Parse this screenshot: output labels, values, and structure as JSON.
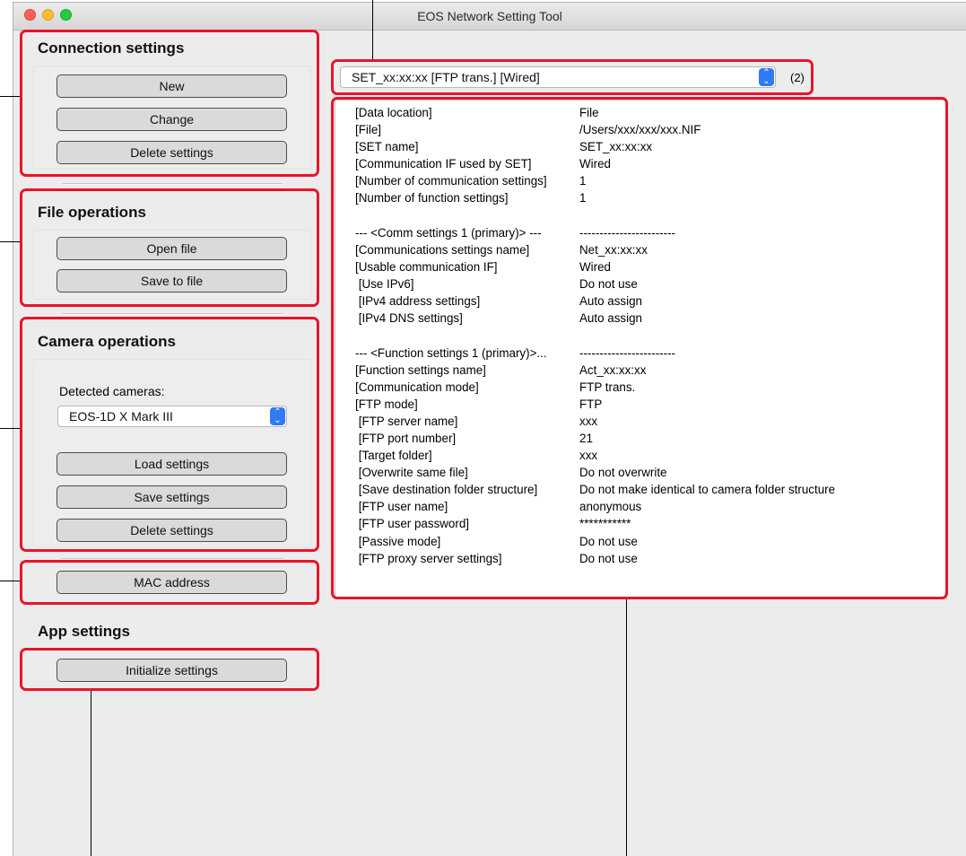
{
  "window": {
    "title": "EOS Network Setting Tool"
  },
  "connection": {
    "heading": "Connection settings",
    "new_label": "New",
    "change_label": "Change",
    "delete_label": "Delete settings"
  },
  "file_ops": {
    "heading": "File operations",
    "open_label": "Open file",
    "save_label": "Save to file"
  },
  "camera_ops": {
    "heading": "Camera operations",
    "detected_label": "Detected cameras:",
    "camera_selected": "EOS-1D X Mark III",
    "load_label": "Load settings",
    "save_label": "Save settings",
    "delete_label": "Delete settings"
  },
  "mac": {
    "label": "MAC address"
  },
  "app_settings": {
    "heading": "App settings",
    "initialize_label": "Initialize settings"
  },
  "set_select": {
    "value": "SET_xx:xx:xx [FTP trans.] [Wired]",
    "annotation": "(2)"
  },
  "details": [
    {
      "k": "[Data location]",
      "v": "File"
    },
    {
      "k": "[File]",
      "v": "/Users/xxx/xxx/xxx.NIF"
    },
    {
      "k": "[SET name]",
      "v": "SET_xx:xx:xx"
    },
    {
      "k": "[Communication IF used by SET]",
      "v": "Wired"
    },
    {
      "k": "[Number of communication settings]",
      "v": "1"
    },
    {
      "k": "[Number of function settings]",
      "v": "1"
    },
    {
      "k": "--- <Comm settings 1 (primary)> ---",
      "v": "------------------------"
    },
    {
      "k": "[Communications settings name]",
      "v": "Net_xx:xx:xx"
    },
    {
      "k": "[Usable communication IF]",
      "v": "Wired"
    },
    {
      "k": " [Use IPv6]",
      "v": "Do not use"
    },
    {
      "k": " [IPv4 address settings]",
      "v": "Auto assign"
    },
    {
      "k": " [IPv4 DNS settings]",
      "v": "Auto assign"
    },
    {
      "k": "--- <Function settings 1 (primary)>...",
      "v": "------------------------"
    },
    {
      "k": "[Function settings name]",
      "v": "Act_xx:xx:xx"
    },
    {
      "k": "[Communication mode]",
      "v": "FTP trans."
    },
    {
      "k": "[FTP mode]",
      "v": "FTP"
    },
    {
      "k": " [FTP server name]",
      "v": "xxx"
    },
    {
      "k": " [FTP port number]",
      "v": "21"
    },
    {
      "k": " [Target folder]",
      "v": "xxx"
    },
    {
      "k": " [Overwrite same file]",
      "v": "Do not overwrite"
    },
    {
      "k": " [Save destination folder structure]",
      "v": "Do not make identical to camera folder structure"
    },
    {
      "k": " [FTP user name]",
      "v": "anonymous"
    },
    {
      "k": " [FTP user password]",
      "v": "***********"
    },
    {
      "k": " [Passive mode]",
      "v": "Do not use"
    },
    {
      "k": " [FTP proxy server settings]",
      "v": "Do not use"
    }
  ],
  "colors": {
    "callout": "#e8142b",
    "accent": "#2f7bf5"
  }
}
